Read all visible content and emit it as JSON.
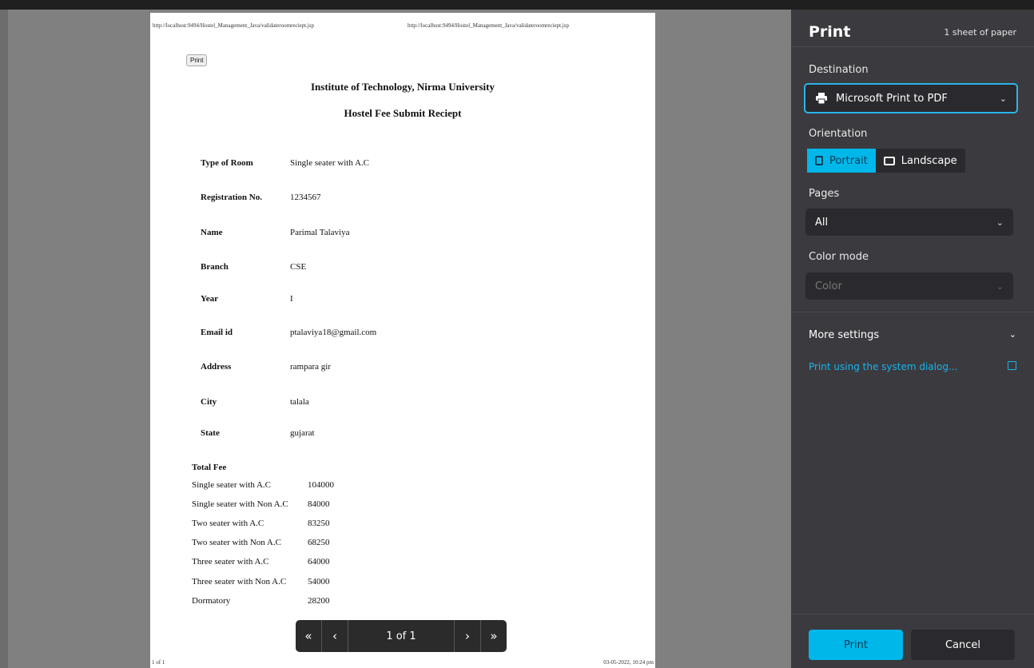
{
  "page": {
    "header_url_left": "http://localhost:9494/Hostel_Management_Java/validateroomreciept.jsp",
    "header_url_right": "http://localhost:9494/Hostel_Management_Java/validateroomreciept.jsp",
    "print_button": "Print",
    "title": "Institute of Technology, Nirma University",
    "subtitle": "Hostel Fee Submit Reciept",
    "fields": [
      {
        "label": "Type of Room",
        "value": "Single seater with A.C"
      },
      {
        "label": "Registration No.",
        "value": "1234567"
      },
      {
        "label": "Name",
        "value": "Parimal Talaviya"
      },
      {
        "label": "Branch",
        "value": "CSE"
      },
      {
        "label": "Year",
        "value": "I"
      },
      {
        "label": "Email id",
        "value": "ptalaviya18@gmail.com"
      },
      {
        "label": "Address",
        "value": "rampara gir"
      },
      {
        "label": "City",
        "value": "talala"
      },
      {
        "label": "State",
        "value": "gujarat"
      }
    ],
    "fee_heading": "Total Fee",
    "fees": [
      {
        "name": "Single seater with A.C",
        "amount": "104000"
      },
      {
        "name": "Single seater with Non A.C",
        "amount": "84000"
      },
      {
        "name": "Two seater with A.C",
        "amount": "83250"
      },
      {
        "name": "Two seater with Non A.C",
        "amount": "68250"
      },
      {
        "name": "Three seater with A.C",
        "amount": "64000"
      },
      {
        "name": "Three seater with Non A.C",
        "amount": "54000"
      },
      {
        "name": "Dormatory",
        "amount": "28200"
      }
    ],
    "footer_left": "1 of 1",
    "footer_right": "03-05-2022, 10:24 pm"
  },
  "pager": {
    "first": "«",
    "prev": "‹",
    "count": "1 of 1",
    "next": "›",
    "last": "»"
  },
  "panel": {
    "title": "Print",
    "sheets": "1 sheet of paper",
    "destination_label": "Destination",
    "destination_value": "Microsoft Print to PDF",
    "orientation_label": "Orientation",
    "portrait": "Portrait",
    "landscape": "Landscape",
    "pages_label": "Pages",
    "pages_value": "All",
    "color_label": "Color mode",
    "color_value": "Color",
    "more_settings": "More settings",
    "system_dialog": "Print using the system dialog...",
    "print_btn": "Print",
    "cancel_btn": "Cancel",
    "accent_color": "#00b7ea",
    "icons": [
      "printer-icon",
      "chevron-down-icon",
      "portrait-icon",
      "landscape-icon",
      "external-link-icon"
    ]
  }
}
